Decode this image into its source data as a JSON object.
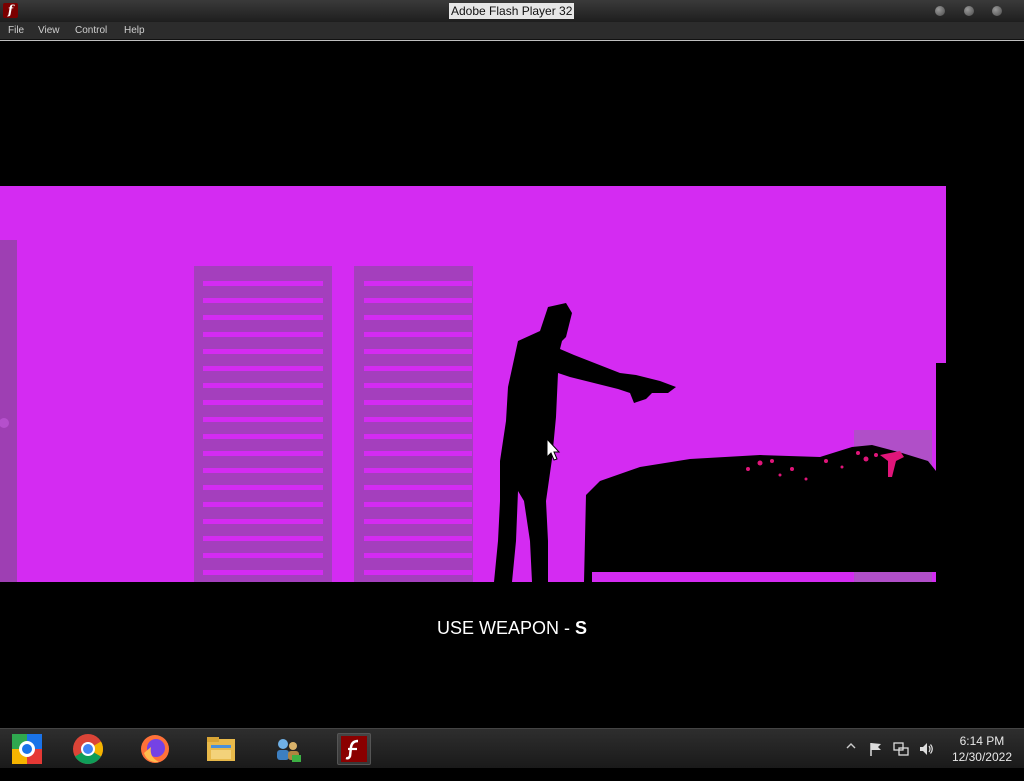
{
  "window": {
    "title": "Adobe Flash Player 32",
    "app_icon_glyph": "f"
  },
  "menu": {
    "items": [
      "File",
      "View",
      "Control",
      "Help"
    ]
  },
  "game": {
    "caption_prefix": "USE WEAPON - ",
    "caption_key": "S",
    "colors": {
      "background": "#d42bf2",
      "panel": "#9e3fb3",
      "silhouette": "#000000",
      "blood": "#e0157a"
    }
  },
  "taskbar": {
    "apps": [
      "app-launcher-icon",
      "chrome-icon",
      "firefox-icon",
      "file-explorer-icon",
      "network-people-icon",
      "flash-player-icon"
    ],
    "clock": {
      "time": "6:14 PM",
      "date": "12/30/2022"
    }
  }
}
